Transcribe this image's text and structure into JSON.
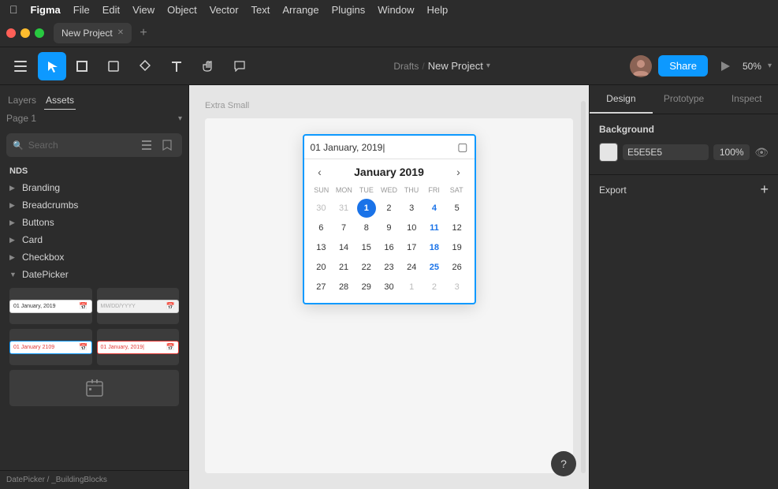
{
  "app": {
    "name": "Figma",
    "menus": [
      "File",
      "Edit",
      "View",
      "Object",
      "Vector",
      "Text",
      "Arrange",
      "Plugins",
      "Window",
      "Help"
    ]
  },
  "tab": {
    "title": "New Project"
  },
  "toolbar": {
    "drafts": "Drafts",
    "separator": "/",
    "project": "New Project",
    "share_btn": "Share",
    "zoom": "50%"
  },
  "left_panel": {
    "tabs": [
      "Layers",
      "Assets"
    ],
    "active_tab": "Assets",
    "page_label": "Page 1",
    "search_placeholder": "Search",
    "nds_label": "NDS",
    "asset_items": [
      {
        "label": "Branding",
        "expanded": false
      },
      {
        "label": "Breadcrumbs",
        "expanded": false
      },
      {
        "label": "Buttons",
        "expanded": false
      },
      {
        "label": "Card",
        "expanded": false
      },
      {
        "label": "Checkbox",
        "expanded": false
      },
      {
        "label": "DatePicker",
        "expanded": true
      }
    ],
    "datepicker_thumbs": [
      {
        "text": "01 January, 2019",
        "state": "normal"
      },
      {
        "text": "MM/DD/YYYY",
        "state": "disabled"
      },
      {
        "text": "01 January 2109",
        "state": "focus"
      },
      {
        "text": "01 January, 2019|",
        "state": "error"
      }
    ],
    "breadcrumb": "DatePicker / _BuildingBlocks"
  },
  "canvas": {
    "label": "Extra Small",
    "date_input_value": "01 January, 2019|",
    "calendar": {
      "month_year": "January 2019",
      "day_names": [
        "SUN",
        "MON",
        "TUE",
        "WED",
        "THU",
        "FRI",
        "SAT"
      ],
      "weeks": [
        [
          "30",
          "31",
          "1",
          "2",
          "3",
          "4",
          "5"
        ],
        [
          "6",
          "7",
          "8",
          "9",
          "10",
          "11",
          "12"
        ],
        [
          "13",
          "14",
          "15",
          "16",
          "17",
          "18",
          "19"
        ],
        [
          "20",
          "21",
          "22",
          "23",
          "24",
          "25",
          "26"
        ],
        [
          "27",
          "28",
          "29",
          "30",
          "1",
          "2",
          "3"
        ]
      ],
      "selected_date": "1",
      "other_month_dates": [
        "30",
        "31",
        "1",
        "2",
        "3"
      ],
      "friday_col": 5
    }
  },
  "right_panel": {
    "tabs": [
      "Design",
      "Prototype",
      "Inspect"
    ],
    "active_tab": "Design",
    "background": {
      "label": "Background",
      "color_code": "E5E5E5",
      "opacity": "100%"
    },
    "export_label": "Export"
  },
  "help_btn": "?"
}
